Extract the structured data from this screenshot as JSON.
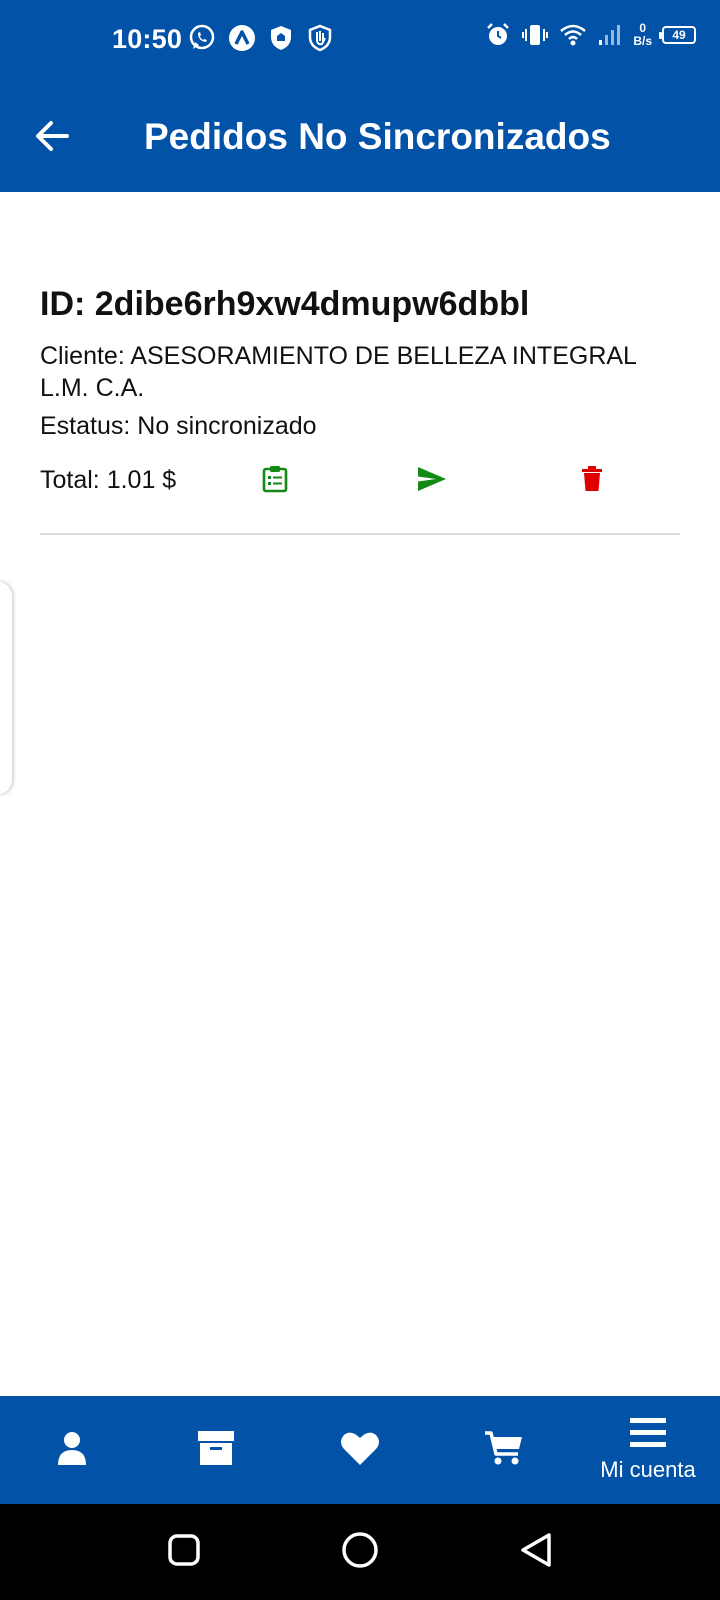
{
  "status_bar": {
    "time": "10:50",
    "net_speed_value": "0",
    "net_speed_unit": "B/s",
    "battery": "49",
    "left_icons": [
      "whatsapp-icon",
      "app-notification-icon",
      "shield-icon",
      "hand-shield-icon"
    ],
    "right_icons": [
      "alarm-icon",
      "vibrate-icon",
      "wifi-icon",
      "signal-icon"
    ]
  },
  "app_bar": {
    "title": "Pedidos No Sincronizados",
    "back_icon": "arrow-left-icon"
  },
  "order": {
    "id": "ID: 2dibe6rh9xw4dmupw6dbbl",
    "client": "Cliente: ASESORAMIENTO DE BELLEZA INTEGRAL L.M. C.A.",
    "status": "Estatus: No sincronizado",
    "total": "Total: 1.01 $",
    "actions": {
      "detail_icon": "clipboard-list-icon",
      "send_icon": "send-icon",
      "delete_icon": "trash-icon"
    }
  },
  "bottom_nav": {
    "items": [
      {
        "icon": "user-icon",
        "label": ""
      },
      {
        "icon": "archive-box-icon",
        "label": ""
      },
      {
        "icon": "heart-icon",
        "label": ""
      },
      {
        "icon": "cart-icon",
        "label": ""
      },
      {
        "icon": "menu-icon",
        "label": "Mi cuenta"
      }
    ]
  },
  "system_nav": {
    "buttons": [
      "recents-square-icon",
      "home-circle-icon",
      "back-triangle-icon"
    ]
  },
  "colors": {
    "primary": "#0252a8",
    "action_green": "#138a13",
    "delete_red": "#e00000",
    "divider": "#dddddd"
  }
}
